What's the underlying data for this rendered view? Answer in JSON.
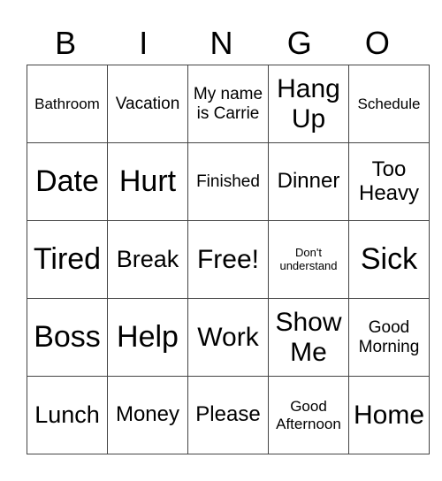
{
  "header": [
    "B",
    "I",
    "N",
    "G",
    "O"
  ],
  "rows": [
    [
      {
        "text": "Bathroom",
        "size": "s17"
      },
      {
        "text": "Vacation",
        "size": "s19"
      },
      {
        "text": "My name is Carrie",
        "size": "s19"
      },
      {
        "text": "Hang Up",
        "size": "s30"
      },
      {
        "text": "Schedule",
        "size": "s17"
      }
    ],
    [
      {
        "text": "Date",
        "size": "s34"
      },
      {
        "text": "Hurt",
        "size": "s34"
      },
      {
        "text": "Finished",
        "size": "s19"
      },
      {
        "text": "Dinner",
        "size": "s24"
      },
      {
        "text": "Too Heavy",
        "size": "s24"
      }
    ],
    [
      {
        "text": "Tired",
        "size": "s34"
      },
      {
        "text": "Break",
        "size": "s26"
      },
      {
        "text": "Free!",
        "size": "s30"
      },
      {
        "text": "Don't understand",
        "size": "s13"
      },
      {
        "text": "Sick",
        "size": "s34"
      }
    ],
    [
      {
        "text": "Boss",
        "size": "s34"
      },
      {
        "text": "Help",
        "size": "s34"
      },
      {
        "text": "Work",
        "size": "s30"
      },
      {
        "text": "Show Me",
        "size": "s30"
      },
      {
        "text": "Good Morning",
        "size": "s19"
      }
    ],
    [
      {
        "text": "Lunch",
        "size": "s26"
      },
      {
        "text": "Money",
        "size": "s24"
      },
      {
        "text": "Please",
        "size": "s24"
      },
      {
        "text": "Good Afternoon",
        "size": "s17"
      },
      {
        "text": "Home",
        "size": "s30"
      }
    ]
  ]
}
